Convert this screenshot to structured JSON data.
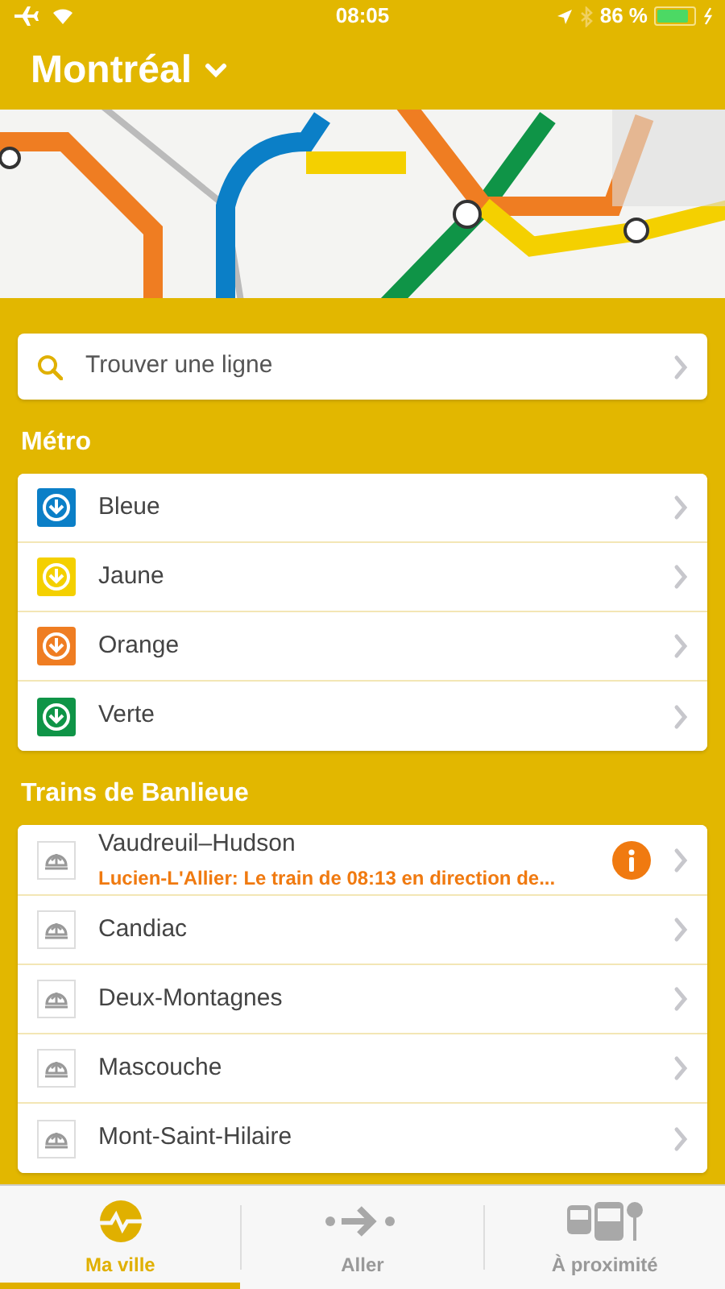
{
  "status_bar": {
    "time": "08:05",
    "battery": "86 %",
    "battery_meter": {
      "level": 0.86
    }
  },
  "header": {
    "title": "Montréal"
  },
  "search": {
    "placeholder": "Trouver une ligne"
  },
  "sections": [
    {
      "title": "Métro",
      "kind": "metro",
      "items": [
        {
          "name": "Bleue",
          "color": "#0b7fc7"
        },
        {
          "name": "Jaune",
          "color": "#f4d000"
        },
        {
          "name": "Orange",
          "color": "#ef7d22"
        },
        {
          "name": "Verte",
          "color": "#0f9447"
        }
      ]
    },
    {
      "title": "Trains de Banlieue",
      "kind": "train",
      "items": [
        {
          "name": "Vaudreuil–Hudson",
          "alert": "Lucien-L'Allier: Le train de 08:13 en direction de..."
        },
        {
          "name": "Candiac"
        },
        {
          "name": "Deux-Montagnes"
        },
        {
          "name": "Mascouche"
        },
        {
          "name": "Mont-Saint-Hilaire"
        }
      ]
    }
  ],
  "tab_bar": [
    {
      "label": "Ma ville",
      "kind": "city",
      "selected": true
    },
    {
      "label": "Aller",
      "kind": "go",
      "selected": false
    },
    {
      "label": "À proximité",
      "kind": "nearby",
      "selected": false
    }
  ]
}
